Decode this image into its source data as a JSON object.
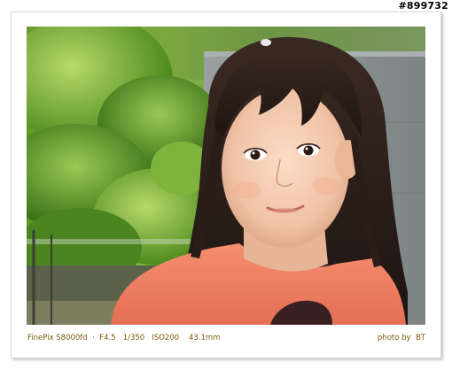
{
  "watermark": "#899732",
  "caption": {
    "exif": "FinePix S8000fd  ·  F4.5   1/350   ISO200    43.1mm",
    "credit": "photo by  BT"
  },
  "photo": {
    "subject": "portrait-of-young-girl",
    "colors": {
      "foliage": "#6fa32e",
      "wall": "#8e9596",
      "shirt": "#f28266",
      "hair": "#2a1d18",
      "skin": "#f2c9b0",
      "caption_text": "#7a5a08"
    }
  }
}
